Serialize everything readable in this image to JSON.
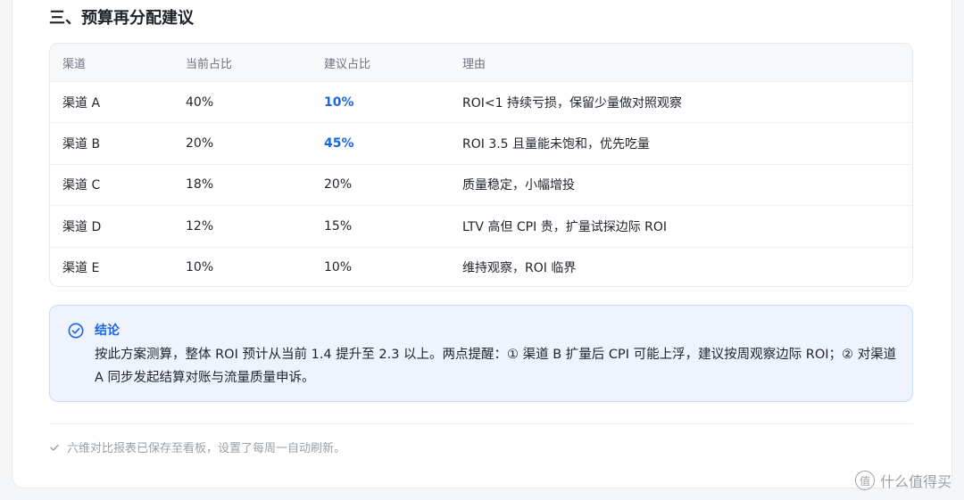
{
  "section": {
    "title": "三、预算再分配建议"
  },
  "table": {
    "headers": [
      "渠道",
      "当前占比",
      "建议占比",
      "理由"
    ],
    "rows": [
      {
        "channel": "渠道 A",
        "current": "40%",
        "suggested": "10%",
        "reason": "ROI<1 持续亏损，保留少量做对照观察",
        "suggested_highlight": true
      },
      {
        "channel": "渠道 B",
        "current": "20%",
        "suggested": "45%",
        "reason": "ROI 3.5 且量能未饱和，优先吃量",
        "suggested_highlight": true
      },
      {
        "channel": "渠道 C",
        "current": "18%",
        "suggested": "20%",
        "reason": "质量稳定，小幅增投",
        "suggested_highlight": false
      },
      {
        "channel": "渠道 D",
        "current": "12%",
        "suggested": "15%",
        "reason": "LTV 高但 CPI 贵，扩量试探边际 ROI",
        "suggested_highlight": false
      },
      {
        "channel": "渠道 E",
        "current": "10%",
        "suggested": "10%",
        "reason": "维持观察，ROI 临界",
        "suggested_highlight": false
      }
    ]
  },
  "conclusion": {
    "icon": "check-circle-icon",
    "title": "结论",
    "text": "按此方案测算，整体 ROI 预计从当前 1.4 提升至 2.3 以上。两点提醒：① 渠道 B 扩量后 CPI 可能上浮，建议按周观察边际 ROI；② 对渠道 A 同步发起结算对账与流量质量申诉。"
  },
  "footer": {
    "icon": "check-icon",
    "note": "六维对比报表已保存至看板，设置了每周一自动刷新。"
  },
  "watermark": {
    "logo_text": "值",
    "text": "什么值得买"
  },
  "colors": {
    "accent": "#1a66e6",
    "callout_bg": "#eef3fd",
    "muted": "#9aa0a6"
  }
}
